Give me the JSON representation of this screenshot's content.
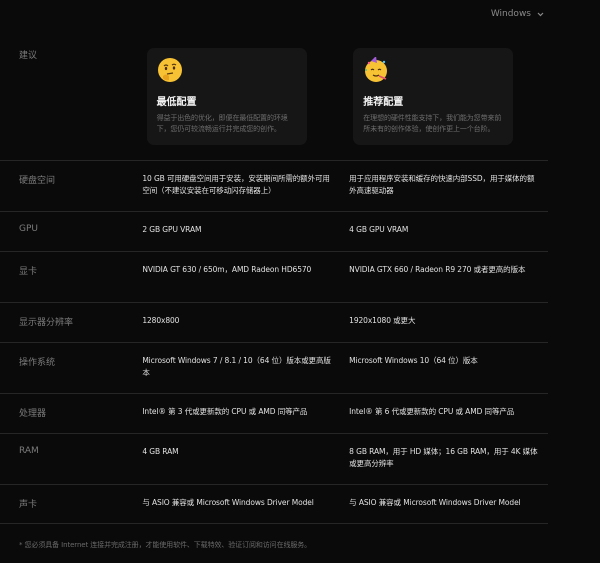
{
  "os_selector": {
    "value": "Windows",
    "icon": "chevron-down-icon"
  },
  "recommend_label": "建议",
  "cards": {
    "min": {
      "emoji": "thinking-face-icon",
      "title": "最低配置",
      "description": "得益于出色的优化，即便在最低配置的环境下，您仍可较流畅运行并完成您的创作。"
    },
    "rec": {
      "emoji": "partying-face-icon",
      "title": "推荐配置",
      "description": "在理想的硬件性能支持下，我们能为您带来前所未有的创作体验，使创作更上一个台阶。"
    }
  },
  "rows": [
    {
      "label": "硬盘空间",
      "min": "10 GB 可用硬盘空间用于安装，安装期间所需的额外可用空间（不建议安装在可移动闪存储器上）",
      "rec": "用于应用程序安装和缓存的快速内部SSD，用于媒体的额外高速驱动器"
    },
    {
      "label": "GPU",
      "min": "2 GB GPU VRAM",
      "rec": "4 GB GPU VRAM"
    },
    {
      "label": "显卡",
      "min": "NVIDIA GT 630 / 650m，AMD Radeon HD6570",
      "rec": "NVIDIA GTX 660 / Radeon R9 270 或者更高的版本"
    },
    {
      "label": "显示器分辨率",
      "min": "1280x800",
      "rec": "1920x1080 或更大"
    },
    {
      "label": "操作系统",
      "min": "Microsoft Windows 7 / 8.1 / 10（64 位）版本或更高版本",
      "rec": "Microsoft Windows 10（64 位）版本"
    },
    {
      "label": "处理器",
      "min": "Intel® 第 3 代或更新款的 CPU 或 AMD 同等产品",
      "rec": "Intel® 第 6 代或更新款的 CPU 或 AMD 同等产品"
    },
    {
      "label": "RAM",
      "min": "4 GB RAM",
      "rec": "8 GB RAM，用于 HD 媒体；16 GB RAM，用于 4K 媒体或更高分辨率"
    },
    {
      "label": "声卡",
      "min": "与 ASIO 兼容或 Microsoft Windows Driver Model",
      "rec": "与 ASIO 兼容或 Microsoft Windows Driver Model"
    }
  ],
  "footnote": "* 您必须具备 Internet 连接并完成注册，才能使用软件、下载特效、验证订阅和访问在线服务。"
}
